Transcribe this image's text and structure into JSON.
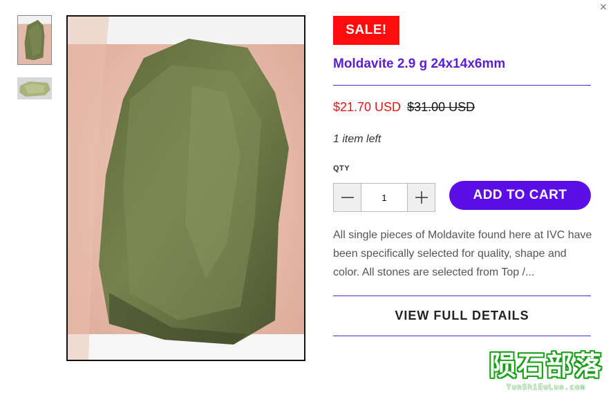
{
  "product": {
    "badge": "SALE!",
    "title": "Moldavite 2.9 g 24x14x6mm",
    "price_current": "$21.70 USD",
    "price_original": "$31.00 USD",
    "stock_note": "1 item left",
    "quantity_label": "QTY",
    "quantity_value": "1",
    "add_to_cart_label": "ADD TO CART",
    "description": "All single pieces of Moldavite found here at IVC have been specifically selected for quality, shape and color. All stones are selected from Top /...",
    "view_details_label": "VIEW FULL DETAILS"
  },
  "icons": {
    "close": "close-icon",
    "minus": "minus-icon",
    "plus": "plus-icon"
  },
  "watermark": {
    "main": "陨石部落",
    "sub": "YunShiEuLuo.com"
  },
  "colors": {
    "accent": "#5b0fe6",
    "sale_badge": "#ff0d0d",
    "sale_price": "#e4141b"
  }
}
